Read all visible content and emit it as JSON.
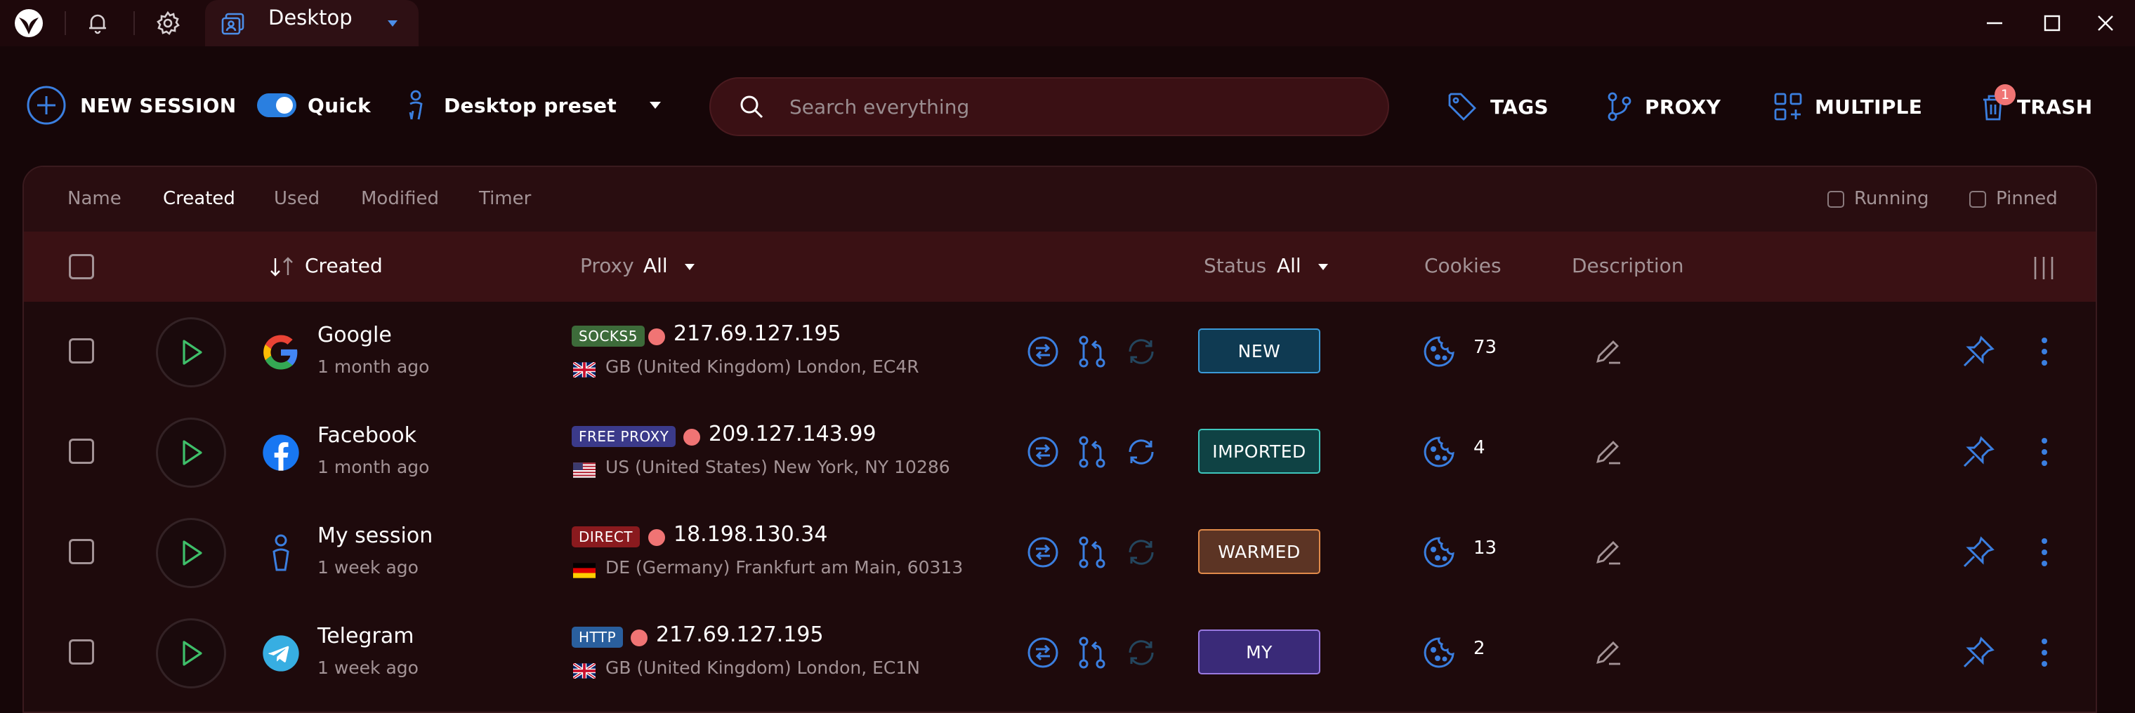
{
  "titlebar": {
    "tab_title": "Desktop"
  },
  "toolbar": {
    "new_session_label": "NEW SESSION",
    "quick_label": "Quick",
    "quick_enabled": true,
    "preset_label": "Desktop preset",
    "search_placeholder": "Search everything",
    "tags_label": "TAGS",
    "proxy_label": "PROXY",
    "multiple_label": "MULTIPLE",
    "trash_label": "TRASH",
    "trash_count": "1"
  },
  "sort": {
    "options": [
      "Name",
      "Created",
      "Used",
      "Modified",
      "Timer"
    ],
    "active": "Created",
    "running_label": "Running",
    "pinned_label": "Pinned"
  },
  "columns": {
    "created": "Created",
    "proxy": "Proxy",
    "proxy_filter": "All",
    "status": "Status",
    "status_filter": "All",
    "cookies": "Cookies",
    "description": "Description"
  },
  "rows": [
    {
      "name": "Google",
      "time": "1 month ago",
      "icon": "google-icon",
      "proxy_type": "SOCKS5",
      "proxy_type_color": "#3d6b3a",
      "ip": "217.69.127.195",
      "flag": "gb-flag",
      "location": "GB (United Kingdom) London, EC4R",
      "status": "NEW",
      "status_bg": "#0f3a52",
      "status_border": "#3b9ad8",
      "cookies": "73",
      "refresh_active": false
    },
    {
      "name": "Facebook",
      "time": "1 month ago",
      "icon": "facebook-icon",
      "proxy_type": "FREE PROXY",
      "proxy_type_color": "#3b3a8a",
      "ip": "209.127.143.99",
      "flag": "us-flag",
      "location": "US (United States) New York, NY 10286",
      "status": "IMPORTED",
      "status_bg": "#0f4244",
      "status_border": "#3ec6bd",
      "cookies": "4",
      "refresh_active": true
    },
    {
      "name": "My session",
      "time": "1 week ago",
      "icon": "person-icon",
      "proxy_type": "DIRECT",
      "proxy_type_color": "#8a1a1e",
      "ip": "18.198.130.34",
      "flag": "de-flag",
      "location": "DE (Germany) Frankfurt am Main, 60313",
      "status": "WARMED",
      "status_bg": "#5c3424",
      "status_border": "#e08a4a",
      "cookies": "13",
      "refresh_active": false
    },
    {
      "name": "Telegram",
      "time": "1 week ago",
      "icon": "telegram-icon",
      "proxy_type": "HTTP",
      "proxy_type_color": "#2a5f9e",
      "ip": "217.69.127.195",
      "flag": "gb-flag",
      "location": "GB (United Kingdom) London, EC1N",
      "status": "MY",
      "status_bg": "#3a2a78",
      "status_border": "#9a7ae0",
      "cookies": "2",
      "refresh_active": false
    }
  ]
}
